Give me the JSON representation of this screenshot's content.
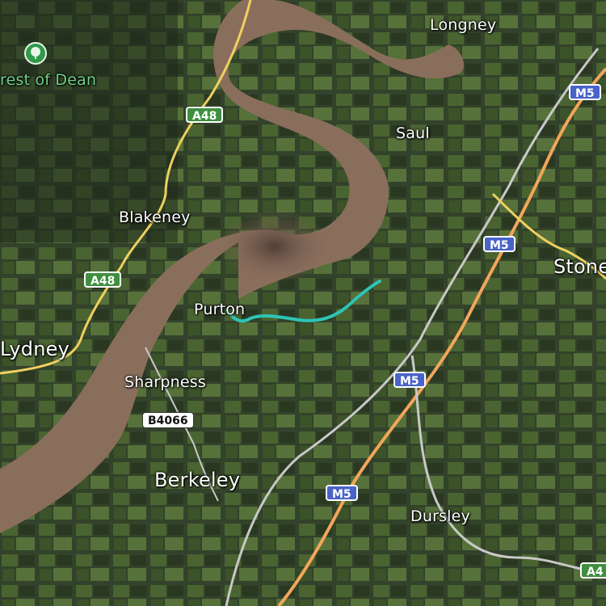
{
  "map": {
    "colors": {
      "land": "#33422a",
      "field_light": "#4e6a34",
      "field_dark": "#263320",
      "river": "#8a6e5c",
      "river_deep": "#5c4a40",
      "motorway": "#f2a65a",
      "a_road": "#f0d060",
      "minor_road": "#c8c8c8",
      "route": "#2ec4b6"
    },
    "places": {
      "longney": "Longney",
      "saul": "Saul",
      "blakeney": "Blakeney",
      "stonehouse": "Stone",
      "purton": "Purton",
      "lydney": "Lydney",
      "sharpness": "Sharpness",
      "berkeley": "Berkeley",
      "dursley": "Dursley",
      "forest_of_dean": "rest of Dean"
    },
    "road_shields": {
      "a48_top": "A48",
      "a48_left": "A48",
      "m5_top": "M5",
      "m5_mid": "M5",
      "m5_low": "M5",
      "m5_bottom": "M5",
      "b4066": "B4066",
      "a4_corner": "A4"
    },
    "icons": {
      "forest": "tree-icon"
    }
  }
}
